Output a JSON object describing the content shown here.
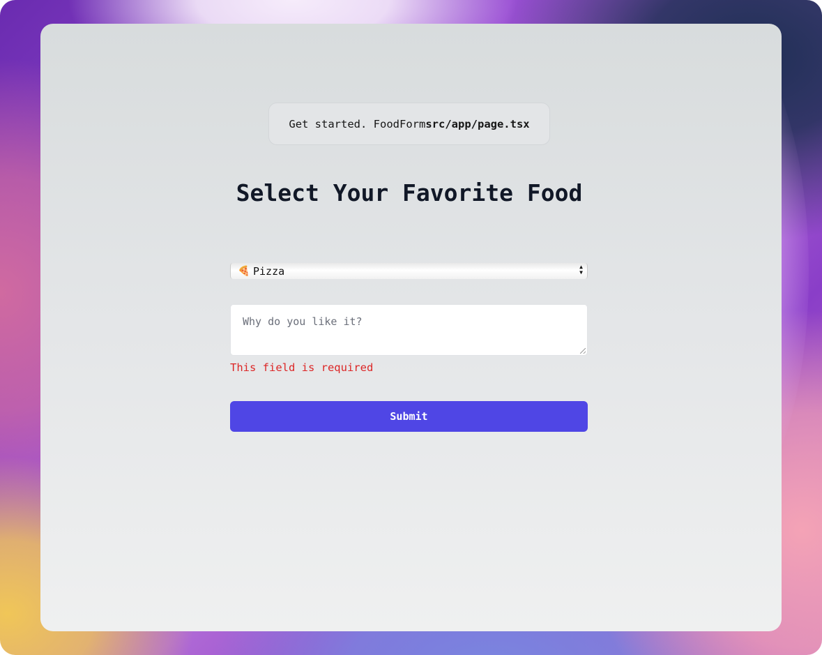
{
  "header": {
    "started_text": "Get started. FoodForm",
    "file_path": "src/app/page.tsx"
  },
  "form": {
    "title": "Select Your Favorite Food",
    "select": {
      "selected_emoji": "🍕",
      "selected_value": "Pizza"
    },
    "reason": {
      "placeholder": "Why do you like it?",
      "value": ""
    },
    "error_text": "This field is required",
    "submit_label": "Submit"
  },
  "colors": {
    "accent": "#4f46e5",
    "error": "#dc2626",
    "title": "#111827"
  }
}
